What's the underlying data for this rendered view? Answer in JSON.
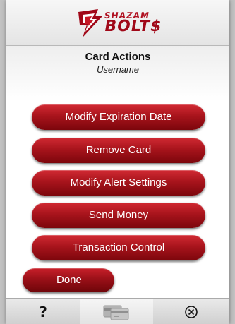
{
  "header": {
    "logo_line1": "SHAZAM",
    "logo_line2": "BOLT$",
    "brand_color": "#a00818"
  },
  "main": {
    "title": "Card Actions",
    "subtitle": "Username",
    "buttons": [
      {
        "label": "Modify Expiration Date"
      },
      {
        "label": "Remove Card"
      },
      {
        "label": "Modify Alert Settings"
      },
      {
        "label": "Send Money"
      },
      {
        "label": "Transaction Control"
      }
    ],
    "done_label": "Done"
  },
  "tabbar": {
    "help_glyph": "?",
    "tabs": [
      {
        "icon": "help-icon"
      },
      {
        "icon": "cards-icon",
        "selected": true
      },
      {
        "icon": "close-circle-icon"
      }
    ]
  }
}
